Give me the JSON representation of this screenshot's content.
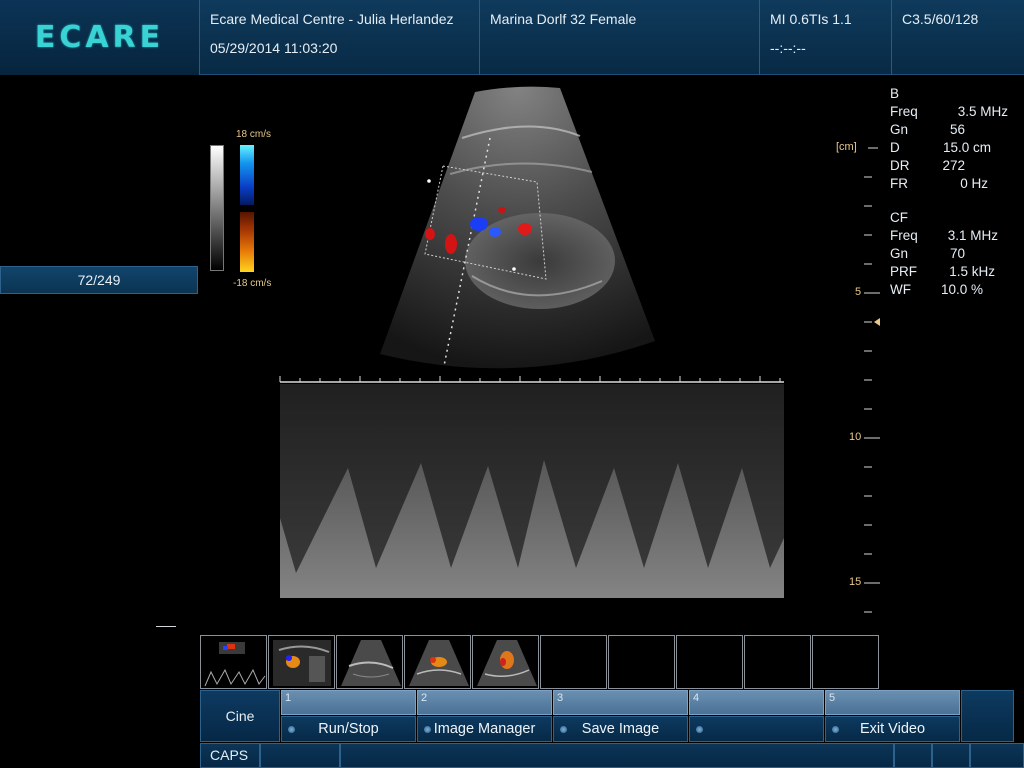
{
  "header": {
    "logo": "ECARE",
    "institution": "Ecare Medical Centre - Julia Herlandez",
    "datetime": "05/29/2014 11:03:20",
    "patient": "Marina Dorlf 32 Female",
    "indices": "MI 0.6TIs 1.1",
    "timer": "--:--:--",
    "probe": "C3.5/60/128"
  },
  "left_panel": {
    "frame_counter": "72/249"
  },
  "color_scale": {
    "top_label": "18 cm/s",
    "bottom_label": "-18 cm/s"
  },
  "depth_scale": {
    "unit_label": "[cm]",
    "labels": [
      "5",
      "10",
      "15"
    ]
  },
  "params": {
    "b_mode": {
      "title": "B",
      "rows": [
        {
          "label": "Freq",
          "value": "3.5 MHz"
        },
        {
          "label": "Gn",
          "value": "56"
        },
        {
          "label": "D",
          "value": "15.0 cm"
        },
        {
          "label": "DR",
          "value": "272"
        },
        {
          "label": "FR",
          "value": "0 Hz"
        }
      ]
    },
    "cf_mode": {
      "title": "CF",
      "rows": [
        {
          "label": "Freq",
          "value": "3.1 MHz"
        },
        {
          "label": "Gn",
          "value": "70"
        },
        {
          "label": "PRF",
          "value": "1.5 kHz"
        },
        {
          "label": "WF",
          "value": "10.0 %"
        }
      ]
    }
  },
  "softkeys": {
    "cine": "Cine",
    "keys": [
      {
        "num": "1",
        "label": "Run/Stop"
      },
      {
        "num": "2",
        "label": "Image Manager"
      },
      {
        "num": "3",
        "label": "Save Image"
      },
      {
        "num": "4",
        "label": ""
      },
      {
        "num": "5",
        "label": "Exit Video"
      }
    ]
  },
  "statusbar": {
    "caps": "CAPS"
  },
  "colors": {
    "header_bg": "#0b3556",
    "logo": "#39d3d6",
    "softkey_number_bg": "#5a82a6",
    "velocity_label": "#e8c98a",
    "scale_label": "#e8c98a"
  }
}
